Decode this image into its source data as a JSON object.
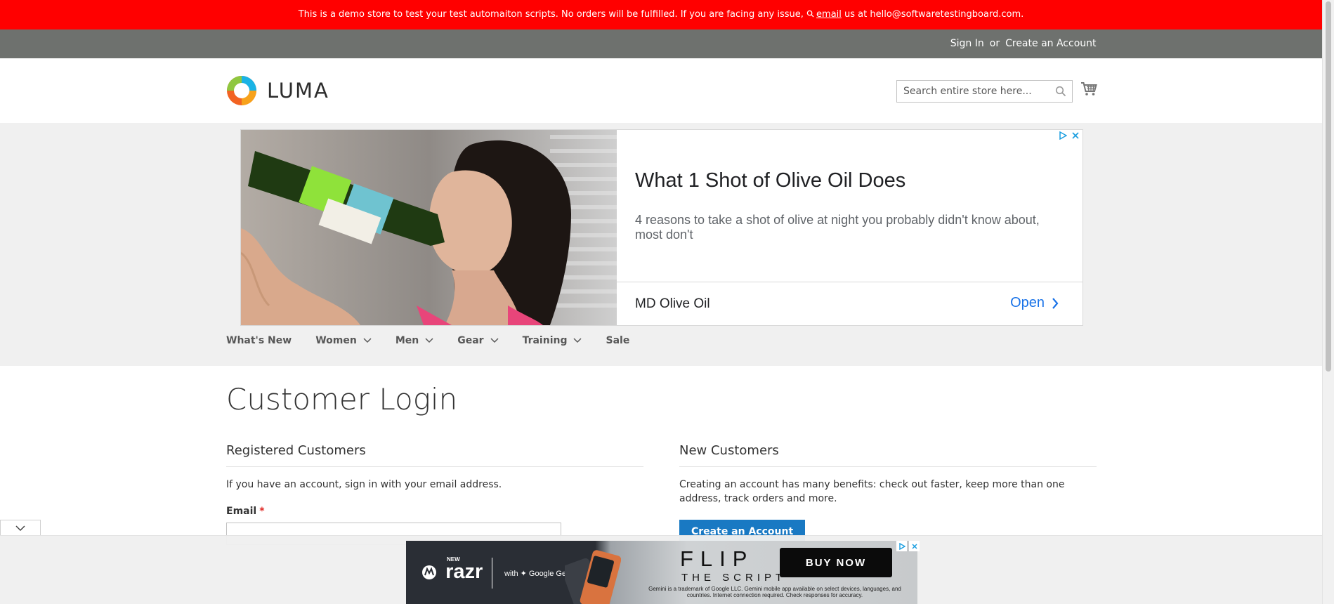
{
  "demo_banner": {
    "text_before": "This is a demo store to test your test automaiton scripts. No orders will be fulfilled. If you are facing any issue, ",
    "link": "email",
    "text_after": " us at hello@softwaretestingboard.com."
  },
  "panel": {
    "sign_in": "Sign In",
    "or": "or",
    "create_account": "Create an Account"
  },
  "header": {
    "logo_text": "LUMA",
    "search_placeholder": "Search entire store here..."
  },
  "ad": {
    "title": "What 1 Shot of Olive Oil Does",
    "description": "4 reasons to take a shot of olive at night you probably didn't know about, most don't",
    "brand": "MD Olive Oil",
    "cta": "Open"
  },
  "nav": {
    "items": [
      {
        "label": "What's New",
        "has_submenu": false
      },
      {
        "label": "Women",
        "has_submenu": true
      },
      {
        "label": "Men",
        "has_submenu": true
      },
      {
        "label": "Gear",
        "has_submenu": true
      },
      {
        "label": "Training",
        "has_submenu": true
      },
      {
        "label": "Sale",
        "has_submenu": false
      }
    ]
  },
  "main": {
    "page_title": "Customer Login",
    "registered": {
      "title": "Registered Customers",
      "text": "If you have an account, sign in with your email address.",
      "email_label": "Email",
      "required_mark": "*"
    },
    "new_customers": {
      "title": "New Customers",
      "text": "Creating an account has many benefits: check out faster, keep more than one address, track orders and more.",
      "button": "Create an Account"
    }
  },
  "bottom_ad": {
    "new": "NEW",
    "razr": "razr",
    "gemini": "with ✦ Google Gemini",
    "flip": "FLIP",
    "script": "THE SCRIPT",
    "fine_print": "Gemini is a trademark of Google LLC. Gemini mobile app available on select devices, languages, and countries. Internet connection required. Check responses for accuracy.",
    "buy": "BUY NOW"
  },
  "colors": {
    "demo_red": "#ff0000",
    "panel_grey": "#6e716e",
    "button_blue": "#1979c3",
    "link_blue": "#1a73e8"
  }
}
